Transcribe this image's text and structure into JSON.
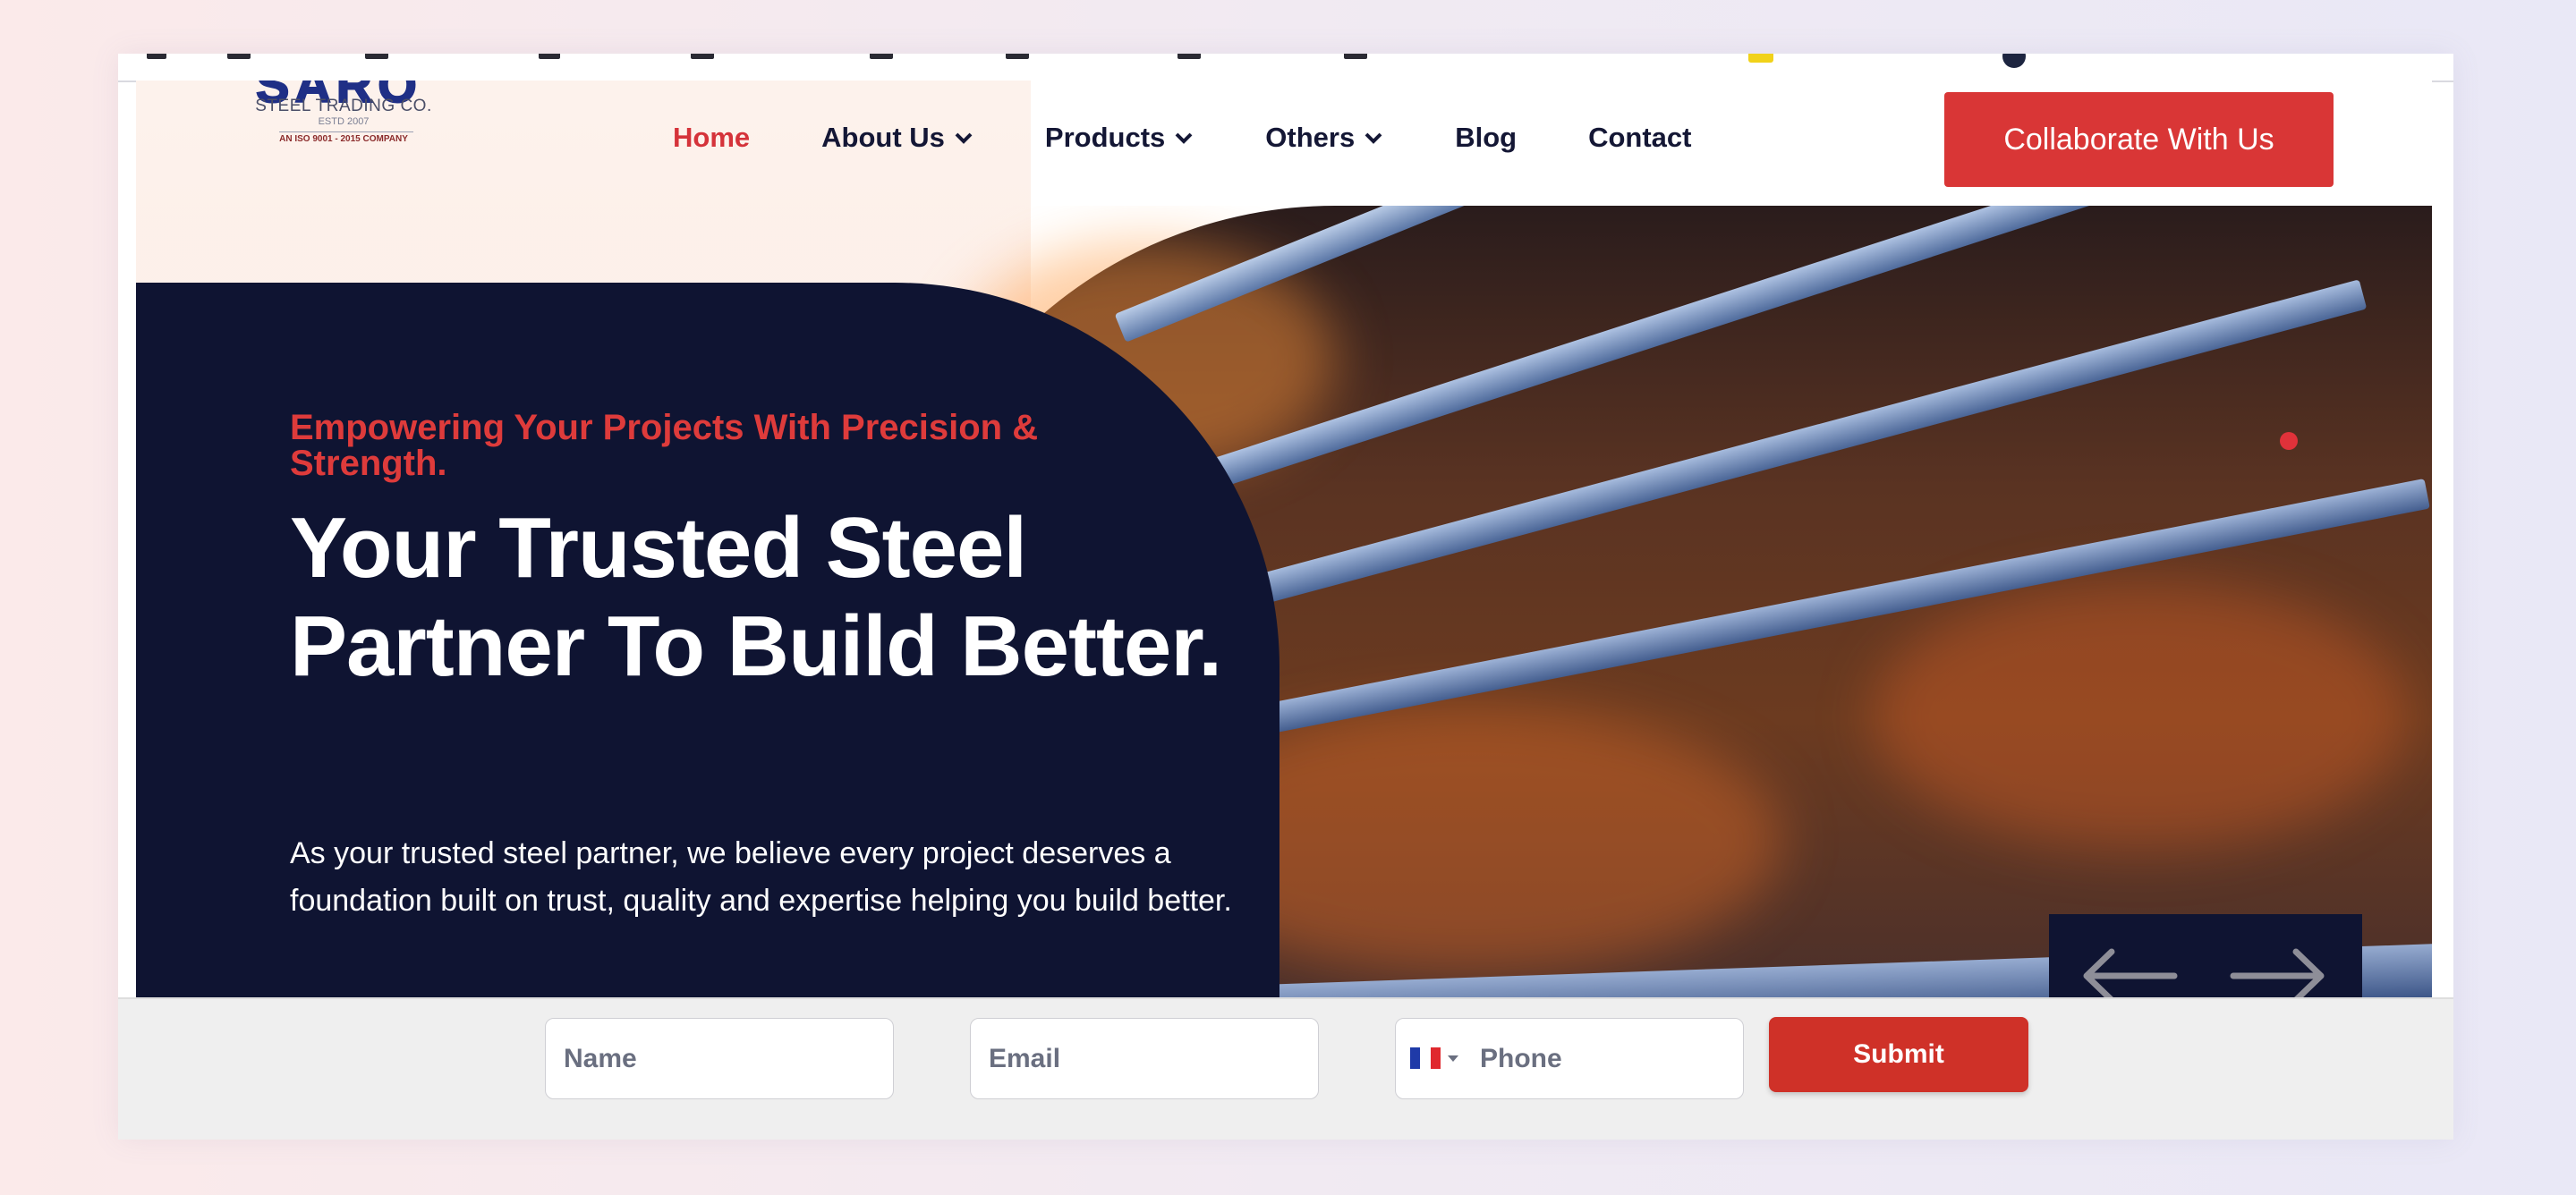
{
  "logo": {
    "mark": "SARO",
    "name": "STEEL TRADING CO.",
    "estd": "ESTD 2007",
    "iso": "AN ISO 9001 - 2015 COMPANY"
  },
  "nav": {
    "items": [
      {
        "label": "Home",
        "active": true,
        "dropdown": false
      },
      {
        "label": "About Us",
        "active": false,
        "dropdown": true
      },
      {
        "label": "Products",
        "active": false,
        "dropdown": true
      },
      {
        "label": "Others",
        "active": false,
        "dropdown": true
      },
      {
        "label": "Blog",
        "active": false,
        "dropdown": false
      },
      {
        "label": "Contact",
        "active": false,
        "dropdown": false
      }
    ],
    "cta": "Collaborate With Us"
  },
  "hero": {
    "tagline": "Empowering Your Projects With Precision & Strength.",
    "headline": "Your Trusted Steel Partner To Build Better.",
    "description": "As your trusted steel partner, we believe every project deserves a foundation built on trust, quality and expertise helping you build better."
  },
  "slider": {
    "prev_icon": "arrow-left-icon",
    "next_icon": "arrow-right-icon"
  },
  "form": {
    "name_placeholder": "Name",
    "email_placeholder": "Email",
    "phone_placeholder": "Phone",
    "country_flag": "france-flag-icon",
    "submit_label": "Submit"
  },
  "colors": {
    "accent_red": "#d93636",
    "navy": "#0f1432",
    "active_nav": "#d5333a",
    "submit_red": "#cf3128"
  }
}
